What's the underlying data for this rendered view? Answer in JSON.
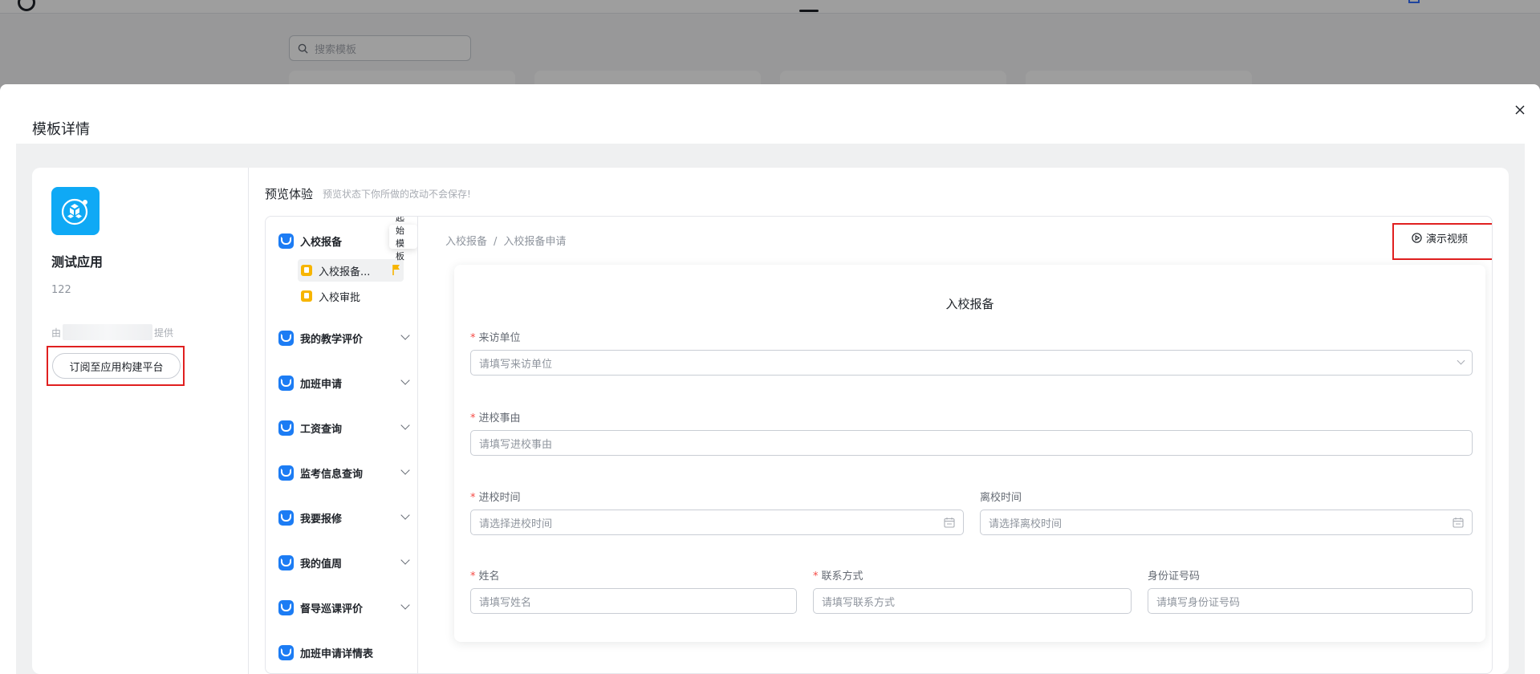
{
  "background": {
    "search_placeholder": "搜索模板"
  },
  "modal": {
    "title": "模板详情"
  },
  "app": {
    "name": "测试应用",
    "description": "122",
    "provider_prefix": "由",
    "provider_suffix": "提供",
    "subscribe_label": "订阅至应用构建平台"
  },
  "preview": {
    "label": "预览体验",
    "hint": "预览状态下你所做的改动不会保存!",
    "tooltip": "起始模板",
    "breadcrumb": [
      "入校报备",
      "入校报备申请"
    ],
    "demo_video_label": "演示视频"
  },
  "tree": {
    "groups": [
      {
        "label": "入校报备",
        "expanded": true
      },
      {
        "label": "我的教学评价"
      },
      {
        "label": "加班申请"
      },
      {
        "label": "工资查询"
      },
      {
        "label": "监考信息查询"
      },
      {
        "label": "我要报修"
      },
      {
        "label": "我的值周"
      },
      {
        "label": "督导巡课评价"
      },
      {
        "label": "加班申请详情表"
      }
    ],
    "items": [
      {
        "label": "入校报备..."
      },
      {
        "label": "入校审批"
      }
    ]
  },
  "form": {
    "title": "入校报备",
    "fields": {
      "visit_unit": {
        "label": "来访单位",
        "placeholder": "请填写来访单位"
      },
      "reason": {
        "label": "进校事由",
        "placeholder": "请填写进校事由"
      },
      "enter_time": {
        "label": "进校时间",
        "placeholder": "请选择进校时间"
      },
      "leave_time": {
        "label": "离校时间",
        "placeholder": "请选择离校时间"
      },
      "name": {
        "label": "姓名",
        "placeholder": "请填写姓名"
      },
      "contact": {
        "label": "联系方式",
        "placeholder": "请填写联系方式"
      },
      "id_number": {
        "label": "身份证号码",
        "placeholder": "请填写身份证号码"
      }
    }
  },
  "colors": {
    "accent": "#1c7cf4",
    "app_icon": "#0fa9f5",
    "highlight": "#e02020",
    "required": "#f54a45"
  }
}
